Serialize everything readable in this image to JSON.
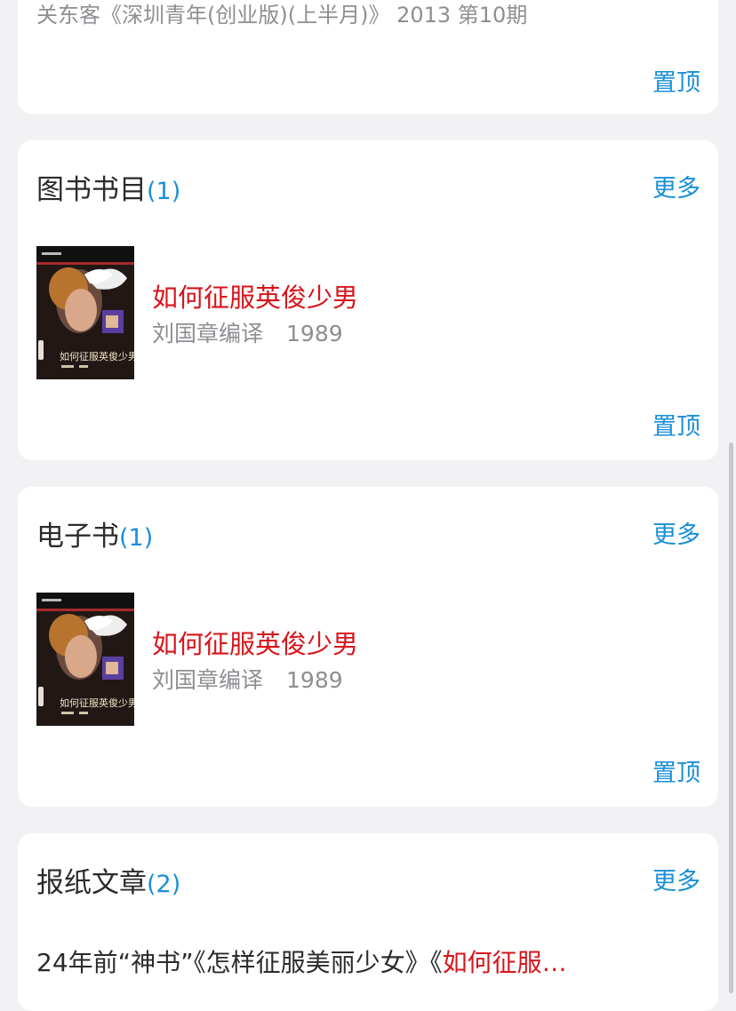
{
  "top_card": {
    "source": "关东客《深圳青年(创业版)(上半月)》 2013 第10期",
    "pin_label": "置顶"
  },
  "books_section": {
    "title": "图书书目",
    "count": "(1)",
    "more_label": "更多",
    "pin_label": "置顶",
    "item": {
      "title": "如何征服英俊少男",
      "author": "刘国章编译",
      "year": "1989",
      "cover_title": "如何征服英俊少男"
    }
  },
  "ebooks_section": {
    "title": "电子书",
    "count": "(1)",
    "more_label": "更多",
    "pin_label": "置顶",
    "item": {
      "title": "如何征服英俊少男",
      "author": "刘国章编译",
      "year": "1989",
      "cover_title": "如何征服英俊少男"
    }
  },
  "news_section": {
    "title": "报纸文章",
    "count": "(2)",
    "more_label": "更多",
    "item": {
      "prefix": "24年前“神书”《怎样征服美丽少女》《",
      "highlight": "如何征服…"
    }
  },
  "colors": {
    "accent": "#1a8fd6",
    "highlight": "#d7141a",
    "background": "#f2f2f4"
  }
}
